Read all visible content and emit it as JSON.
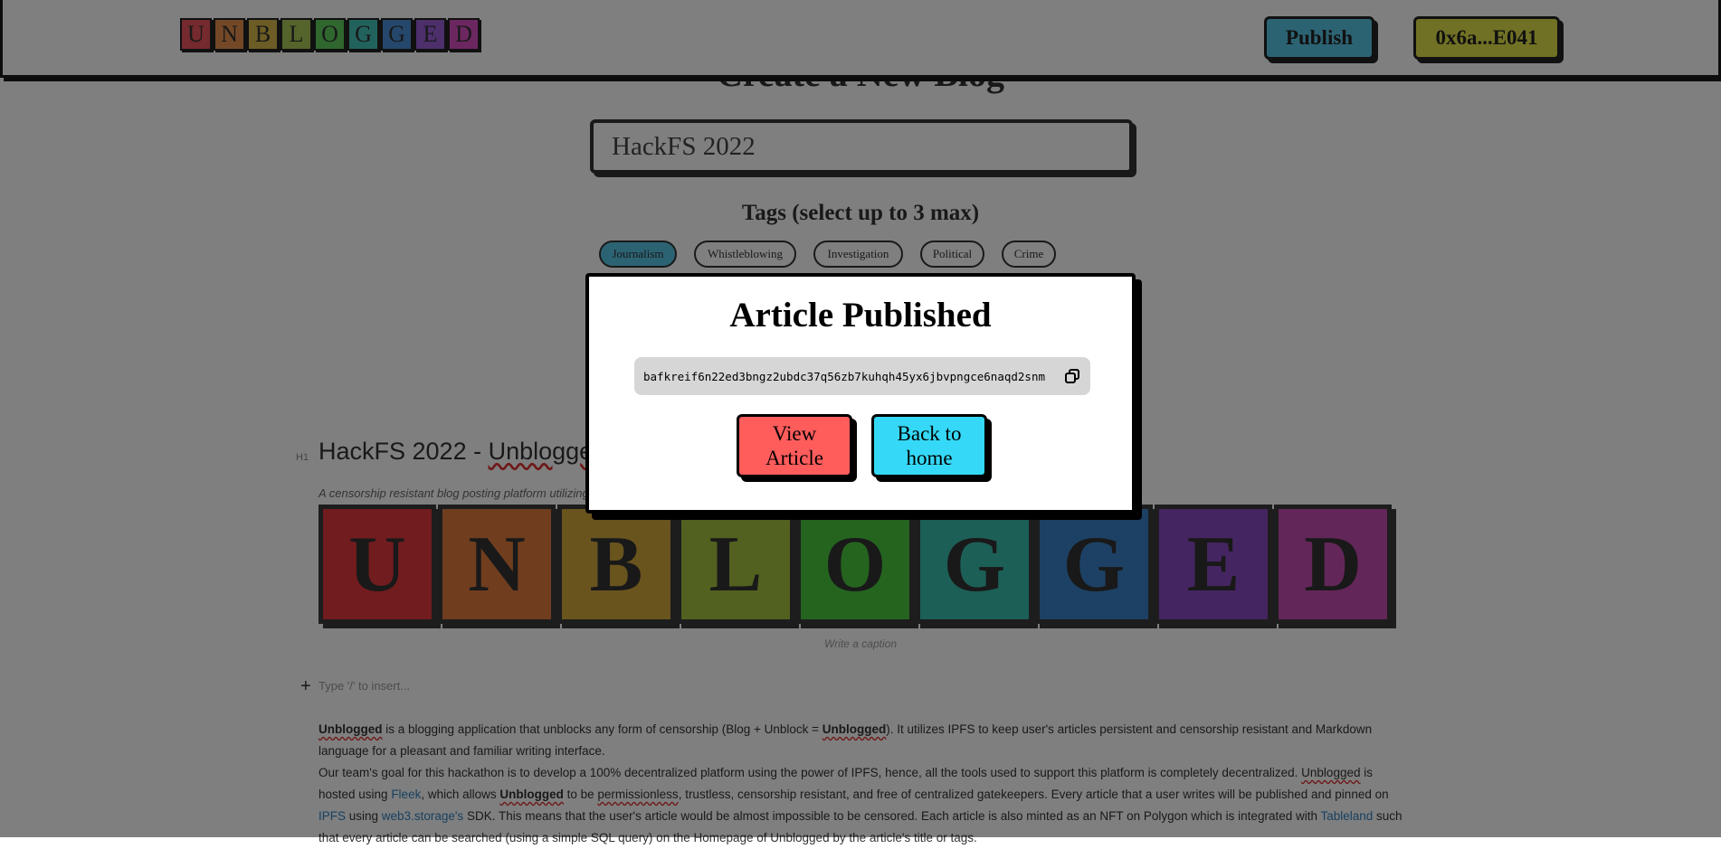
{
  "header": {
    "logo_letters": [
      "U",
      "N",
      "B",
      "L",
      "O",
      "G",
      "G",
      "E",
      "D"
    ],
    "logo_colors": [
      "#e8545c",
      "#e8904e",
      "#d9b84b",
      "#a9c956",
      "#5fce5e",
      "#45c4b8",
      "#4a8fd6",
      "#9a5fd8",
      "#d94ec2"
    ],
    "publish_label": "Publish",
    "publish_color": "#58c6e6",
    "wallet_label": "0x6a...E041",
    "wallet_color": "#e3e24a"
  },
  "editor": {
    "page_heading": "Create a New Blog",
    "title_value": "HackFS 2022",
    "tags_heading": "Tags (select up to 3 max)",
    "tags": [
      "Journalism",
      "Whistleblowing",
      "Investigation",
      "Political",
      "Crime"
    ],
    "selected_tag_color": "#58c6e6",
    "h1_marker": "H1",
    "doc_title_prefix": "HackFS 2022 - ",
    "doc_title_word": "Unblogged",
    "doc_subtitle": "A censorship resistant blog posting platform utilizing IPFS",
    "banner_letters": [
      "U",
      "N",
      "B",
      "L",
      "O",
      "G",
      "G",
      "E",
      "D"
    ],
    "banner_colors": [
      "#e2393e",
      "#e07c3e",
      "#d2a83c",
      "#a4c23e",
      "#4bc93e",
      "#38bfae",
      "#3a82c8",
      "#8a4ac2",
      "#c74cb2"
    ],
    "caption_placeholder": "Write a caption",
    "insert_placeholder": "Type '/' to insert...",
    "paragraph1": {
      "w1": "Unblogged",
      "t1": " is a blogging application that unblocks any form of censorship (Blog + Unblock = ",
      "w2": "Unblogged",
      "t2": "). It utilizes IPFS to keep user's articles persistent and censorship resistant and Markdown language for a pleasant and familiar writing interface."
    },
    "paragraph2": {
      "t1": "Our team's goal for this hackathon is to develop a 100% decentralized platform using the power of IPFS, hence, all the tools used to support this platform is completely decentralized. ",
      "w1": "Unblogged",
      "t2": " is hosted using ",
      "l1": "Fleek",
      "t3": ", which allows ",
      "w2": "Unblogged",
      "t4": " to be ",
      "w3": "permissionless",
      "t5": ", trustless, censorship resistant, and free of centralized gatekeepers. Every article that a user writes will be published and pinned on ",
      "l2": "IPFS",
      "t6": " using ",
      "l3": "web3.storage's",
      "t7": " SDK. This means that the user's article would be almost impossible to be censored. Each article is also minted as an NFT on Polygon which is integrated with ",
      "l4": "Tableland",
      "t8": " such that every article can be searched (using a simple SQL query) on the Homepage of Unblogged by the article's title or tags."
    }
  },
  "modal": {
    "title": "Article Published",
    "cid": "bafkreif6n22ed3bngz2ubdc37q56zb7kuhqh45yx6jbvpngce6naqd2snm",
    "view_label": "View Article",
    "view_color": "#ff5c5c",
    "home_label": "Back to home",
    "home_color": "#35d9f7"
  }
}
